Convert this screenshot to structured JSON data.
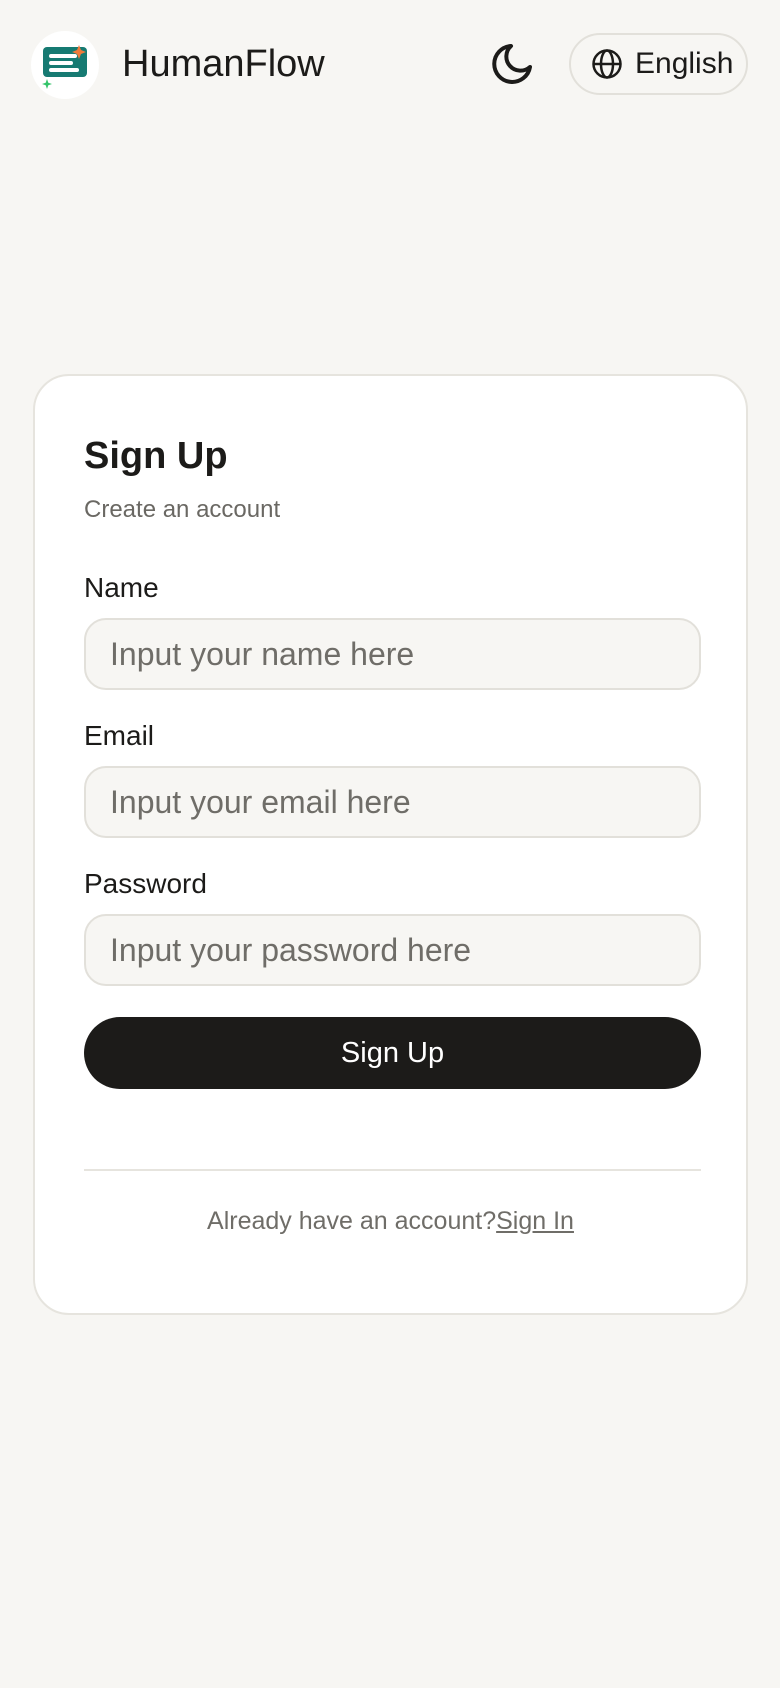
{
  "header": {
    "app_name": "HumanFlow",
    "theme_icon": "moon-icon",
    "language_icon": "globe-icon",
    "language_label": "English"
  },
  "colors": {
    "background": "#f7f6f3",
    "logo_teal": "#167a72",
    "logo_orange": "#f07a3a",
    "logo_green": "#34c46a",
    "button_dark": "#1c1b19"
  },
  "form": {
    "title": "Sign Up",
    "subtitle": "Create an account",
    "fields": [
      {
        "label": "Name",
        "placeholder": "Input your name here",
        "value": ""
      },
      {
        "label": "Email",
        "placeholder": "Input your email here",
        "value": ""
      },
      {
        "label": "Password",
        "placeholder": "Input your password here",
        "value": ""
      }
    ],
    "submit_label": "Sign Up"
  },
  "footer": {
    "prompt": "Already have an account?",
    "link_label": "Sign In"
  }
}
